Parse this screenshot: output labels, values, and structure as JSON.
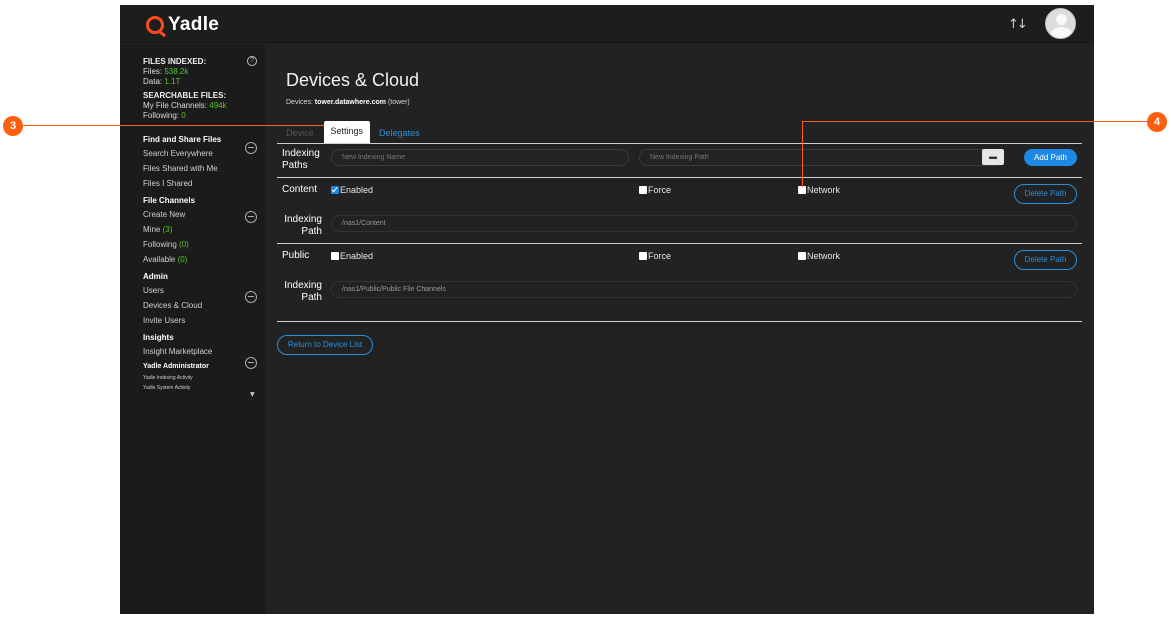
{
  "app": {
    "logo_text": "Yadle",
    "brand_color": "#ff4a1c",
    "accent_color": "#1e88e5",
    "green_color": "#58c52a"
  },
  "header": {
    "sort_icon": "sort-arrows-icon",
    "avatar": "user-avatar"
  },
  "sidebar": {
    "files_indexed_label": "FILES INDEXED:",
    "files_label": "Files:",
    "files_value": "538.2k",
    "data_label": "Data:",
    "data_value": "1.1T",
    "searchable_label": "SEARCHABLE FILES:",
    "my_channels_label": "My File Channels:",
    "my_channels_value": "494k",
    "following_label": "Following:",
    "following_value": "0",
    "sections": {
      "find": {
        "title": "Find and Share Files",
        "items": [
          "Search Everywhere",
          "Files Shared with Me",
          "Files I Shared"
        ]
      },
      "channels": {
        "title": "File Channels",
        "create": "Create New",
        "mine": "Mine",
        "mine_count": "(3)",
        "following": "Following",
        "following_count": "(0)",
        "available": "Available",
        "available_count": "(0)"
      },
      "admin": {
        "title": "Admin",
        "items": [
          "Users",
          "Devices & Cloud",
          "Invite Users"
        ]
      },
      "insights": {
        "title": "Insights",
        "items": [
          "Insight Marketplace"
        ]
      },
      "yadle_admin": {
        "title": "Yadle Administrator",
        "items": [
          "Yadle Indexing Activity",
          "Yadle System Activity"
        ]
      }
    }
  },
  "main": {
    "title": "Devices & Cloud",
    "devices_label": "Devices:",
    "device_host": "tower.datawhere.com",
    "device_name": "(tower)",
    "tabs": {
      "device": "Device",
      "settings": "Settings",
      "delegates": "Delegates"
    },
    "new_path": {
      "label_line1": "Indexing",
      "label_line2": "Paths",
      "name_placeholder": "New Indexing Name",
      "path_placeholder": "New Indexing Path",
      "add_label": "Add Path"
    },
    "paths": [
      {
        "name": "Content",
        "enabled_label": "Enabled",
        "enabled": true,
        "force_label": "Force",
        "force": false,
        "network_label": "Network",
        "network": false,
        "delete_label": "Delete Path",
        "path_label_1": "Indexing",
        "path_label_2": "Path",
        "path_value": "/nas1/Content"
      },
      {
        "name": "Public",
        "enabled_label": "Enabled",
        "enabled": false,
        "force_label": "Force",
        "force": false,
        "network_label": "Network",
        "network": false,
        "delete_label": "Delete Path",
        "path_label_1": "Indexing",
        "path_label_2": "Path",
        "path_value": "/nas1/Public/Public File Channels"
      }
    ],
    "return_label": "Return to Device List"
  },
  "callouts": {
    "left": "3",
    "right": "4"
  }
}
